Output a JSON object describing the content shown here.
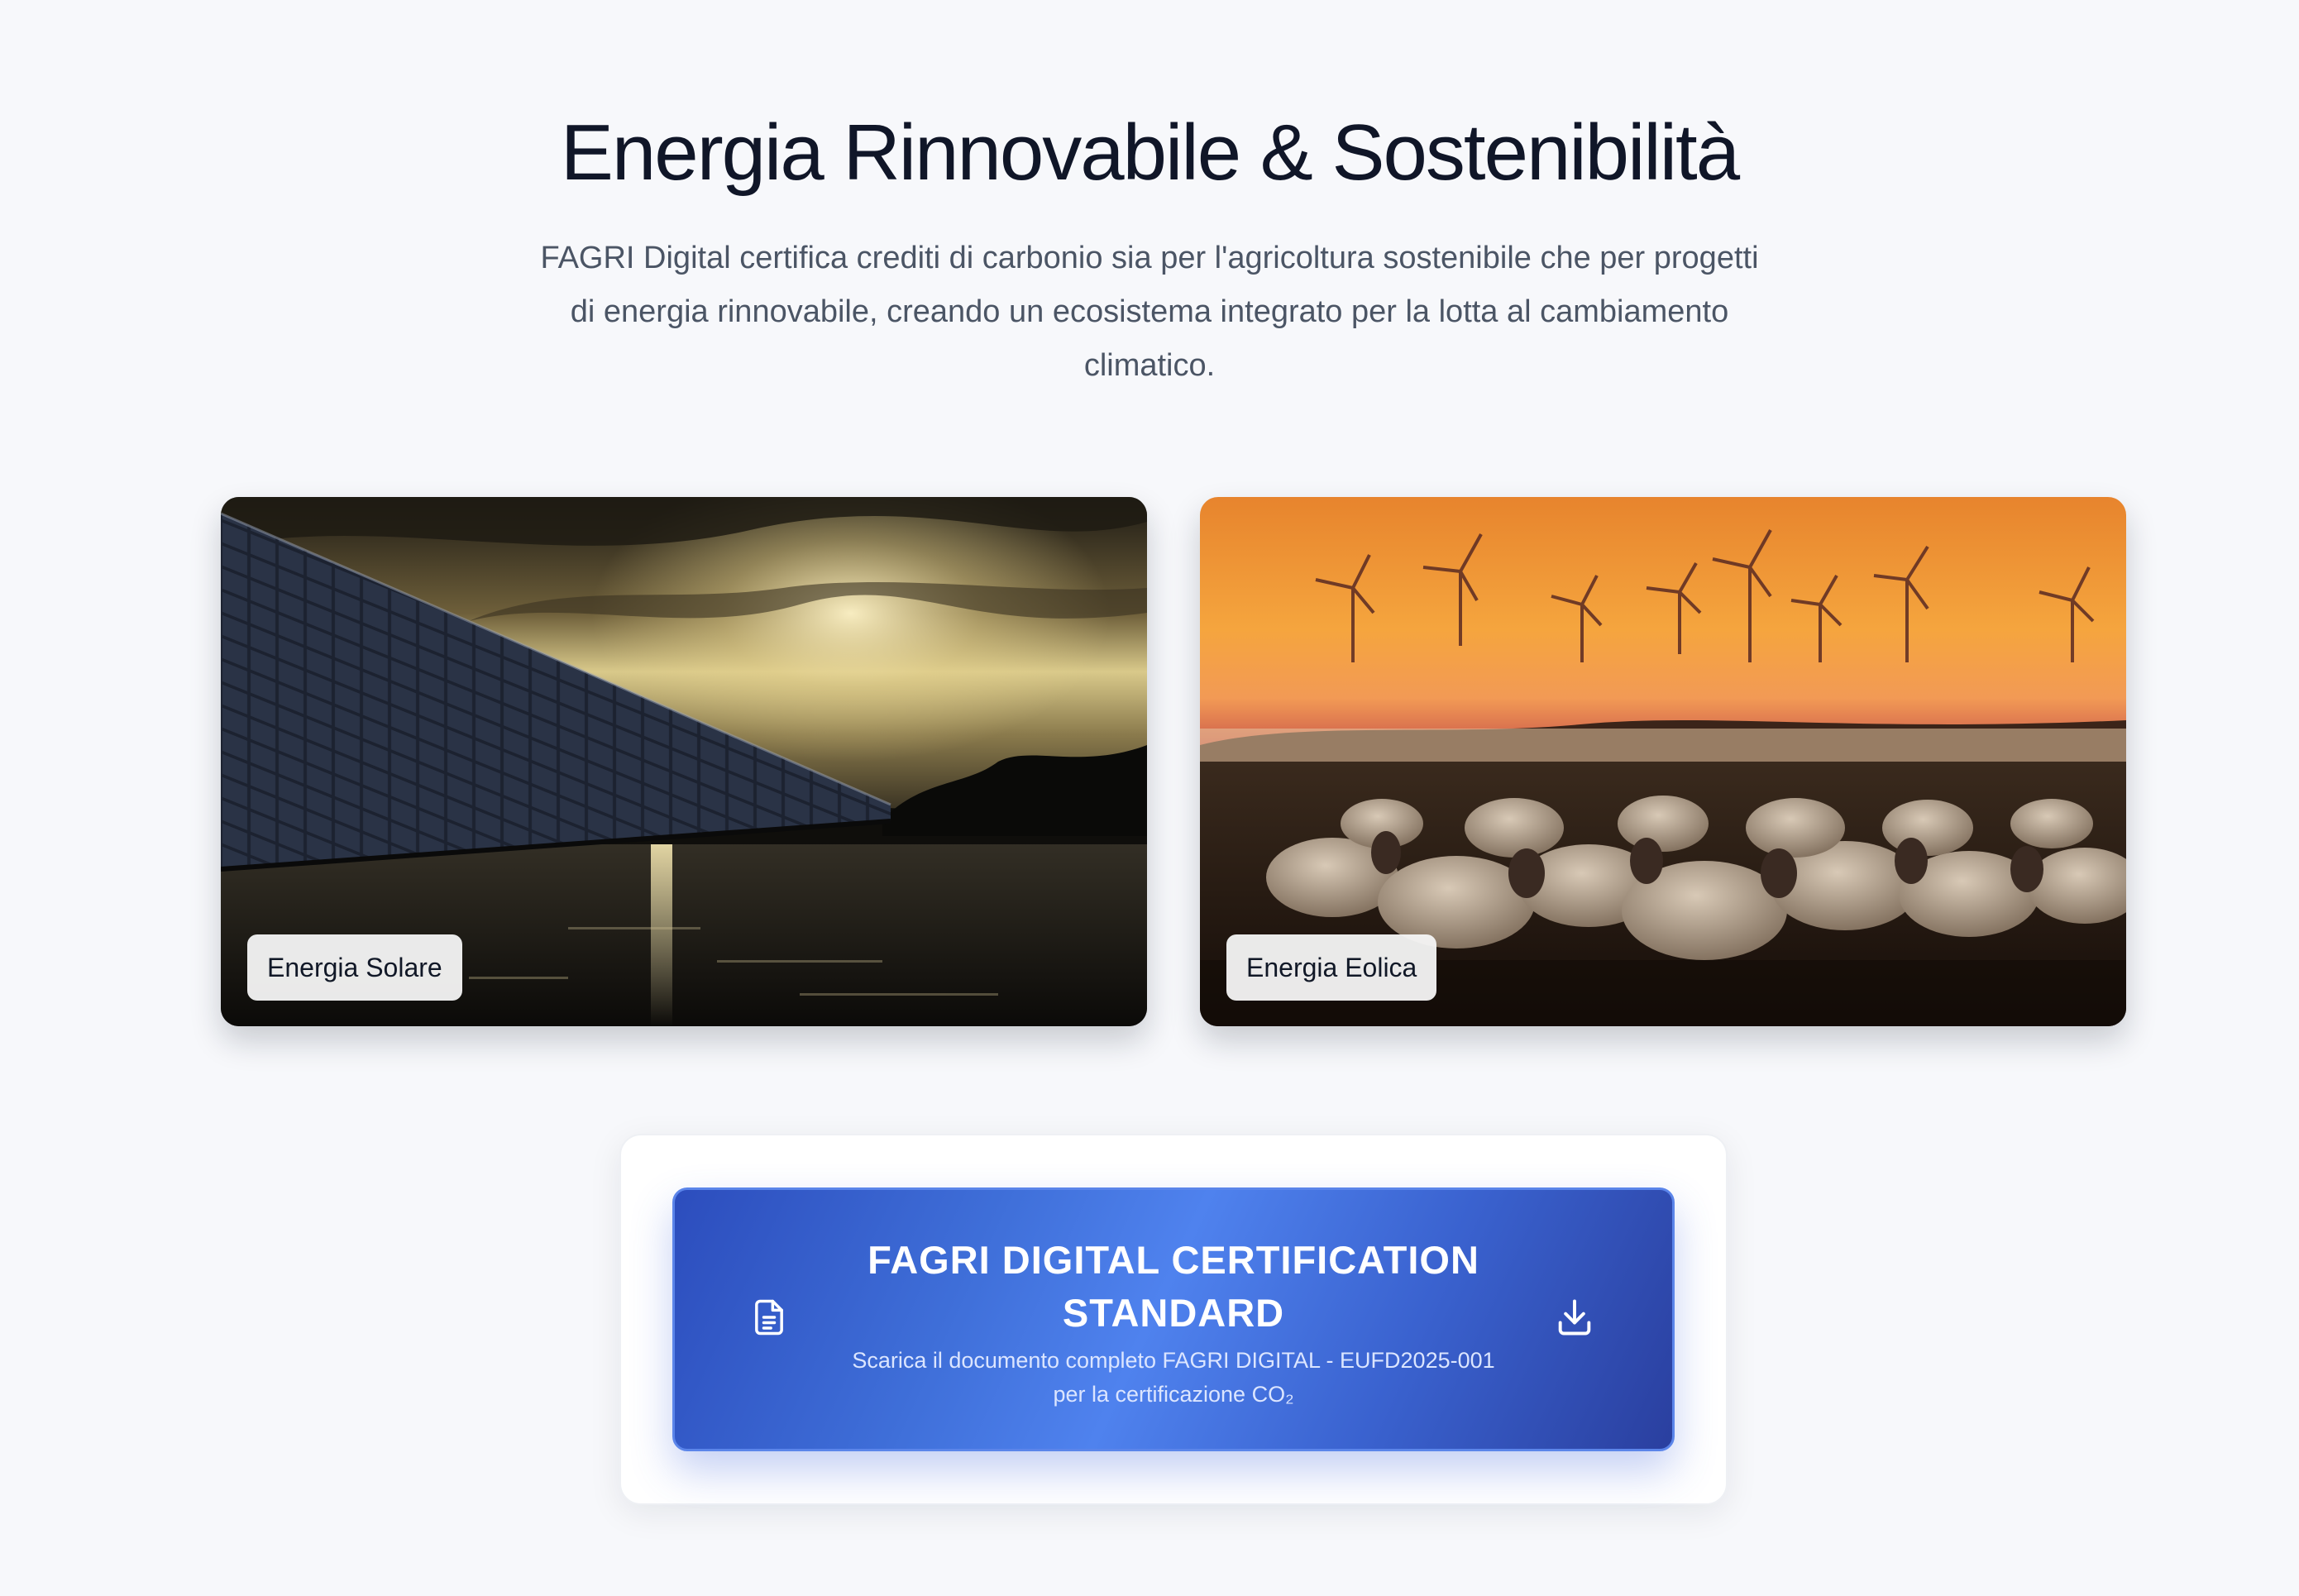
{
  "header": {
    "title": "Energia Rinnovabile & Sostenibilità",
    "description_line1": "FAGRI Digital certifica crediti di carbonio sia per l'agricoltura sostenibile che per progetti",
    "description_line2": "di energia rinnovabile, creando un ecosistema integrato per la lotta al cambiamento",
    "description_line3": "climatico."
  },
  "cards": [
    {
      "label": "Energia Solare",
      "image": "solar-panels-at-sunset-photo"
    },
    {
      "label": "Energia Eolica",
      "image": "sheep-and-wind-turbines-photo"
    }
  ],
  "cta": {
    "title_line1": "FAGRI DIGITAL CERTIFICATION",
    "title_line2": "STANDARD",
    "desc_line1": "Scarica il documento completo FAGRI DIGITAL - EUFD2025-001",
    "desc_line2": "per la certificazione CO₂",
    "left_icon": "document-icon",
    "right_icon": "download-icon"
  },
  "colors": {
    "background": "#f7f8fb",
    "title": "#101628",
    "body_text": "#4b5565",
    "cta_gradient_start": "#2c4dbd",
    "cta_gradient_mid": "#4f82ee",
    "cta_gradient_end": "#2a3f9f",
    "cta_border": "#5b85ea"
  }
}
